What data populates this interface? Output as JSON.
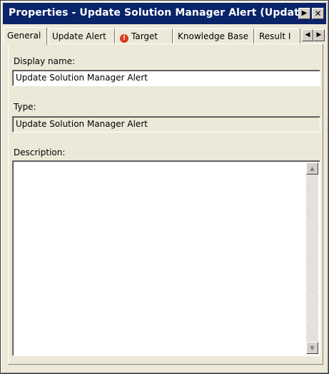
{
  "window": {
    "title": "Properties - Update Solution Manager Alert (Updat...",
    "arrow_glyph": "▶",
    "close_glyph": "✕"
  },
  "tabs": [
    {
      "label": "General",
      "active": true
    },
    {
      "label": "Update Alert"
    },
    {
      "label": "Target",
      "icon": "error-icon"
    },
    {
      "label": "Knowledge Base"
    },
    {
      "label": "Result I"
    }
  ],
  "tab_scroll": {
    "left": "◀",
    "right": "▶"
  },
  "error_icon_glyph": "!",
  "form": {
    "display_name_label": "Display name:",
    "display_name_value": "Update Solution Manager Alert",
    "type_label": "Type:",
    "type_value": "Update Solution Manager Alert",
    "description_label": "Description:",
    "description_value": ""
  },
  "scrollbar": {
    "up": "▲",
    "down": "▼"
  },
  "colors": {
    "titlebar": "#0a246a",
    "dialog_bg": "#ece9d8",
    "error": "#d9391c"
  }
}
